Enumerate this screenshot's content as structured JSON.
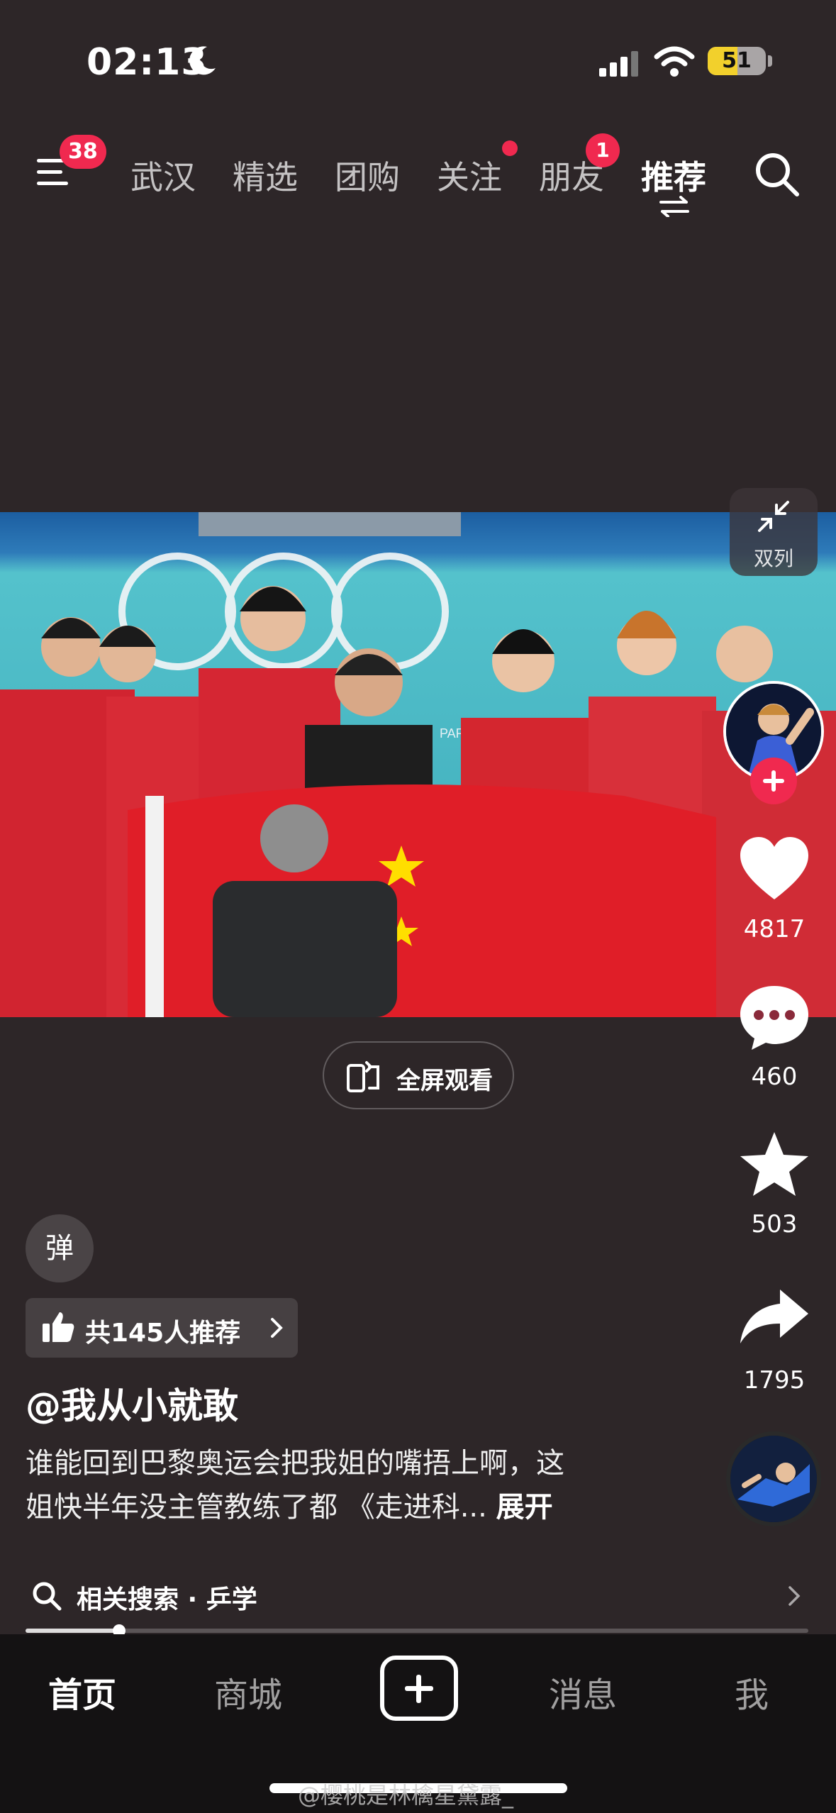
{
  "status_bar": {
    "time": "02:13",
    "battery": "51",
    "battery_level": 0.51
  },
  "top_nav": {
    "menu_badge": "38",
    "tabs": [
      {
        "label": "武汉"
      },
      {
        "label": "精选"
      },
      {
        "label": "团购"
      },
      {
        "label": "关注"
      },
      {
        "label": "朋友",
        "badge": "1"
      },
      {
        "label": "推荐"
      }
    ],
    "active_tab": "推荐"
  },
  "video": {
    "double_column_label": "双列",
    "fullscreen_label": "全屏观看",
    "overlay_text": "PARIS 2024"
  },
  "actions": {
    "likes": "4817",
    "comments": "460",
    "favorites": "503",
    "shares": "1795"
  },
  "post": {
    "danmu_label": "弹",
    "recommend_label": "共145人推荐",
    "author": "@我从小就敢",
    "caption_line1": "谁能回到巴黎奥运会把我姐的嘴捂上啊，这",
    "caption_line2": "姐快半年没主管教练了都 《走进科...",
    "expand_label": "展开",
    "related_search": "相关搜索 · 乒学",
    "progress": 0.12
  },
  "bottom_nav": {
    "tabs": [
      {
        "label": "首页"
      },
      {
        "label": "商城"
      },
      {
        "label": "消息"
      },
      {
        "label": "我"
      }
    ],
    "active_tab": "首页"
  },
  "watermark": "@樱桃是林檎星黛露_",
  "colors": {
    "badge": "#f0294f",
    "background": "#2d2628",
    "tabbar": "#141213"
  }
}
